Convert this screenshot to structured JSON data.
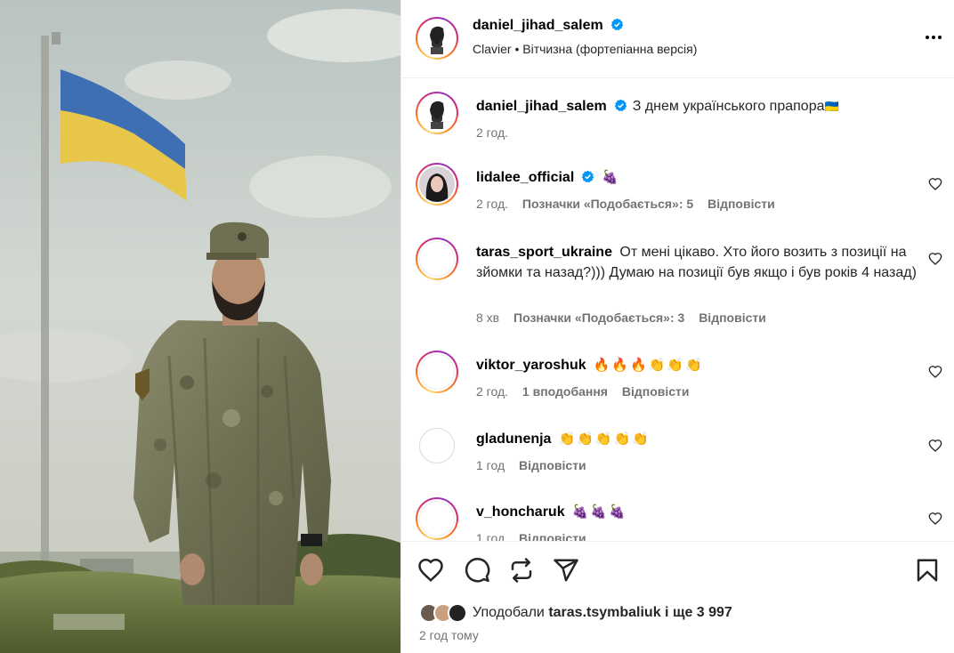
{
  "header": {
    "username": "daniel_jihad_salem",
    "audio": "Clavier • Вітчизна (фортепіанна версія)"
  },
  "caption": {
    "username": "daniel_jihad_salem",
    "text": "З днем українського прапора",
    "flag_emoji": "🇺🇦",
    "time": "2 год."
  },
  "comments": [
    {
      "username": "lidalee_official",
      "verified": true,
      "text": "",
      "emojis": "🍇",
      "time": "2 год.",
      "likes": "Позначки «Подобається»: 5",
      "reply": "Відповісти"
    },
    {
      "username": "taras_sport_ukraine",
      "verified": false,
      "text": "От мені цікаво. Хто його возить з позиції на зйомки та назад?))) Думаю на позиції був якщо і був років 4 назад)",
      "emojis": "",
      "time": "8 хв",
      "likes": "Позначки «Подобається»: 3",
      "reply": "Відповісти"
    },
    {
      "username": "viktor_yaroshuk",
      "verified": false,
      "text": "",
      "emojis": "🔥🔥🔥👏👏👏",
      "time": "2 год.",
      "likes": "1 вподобання",
      "reply": "Відповісти"
    },
    {
      "username": "gladunenja",
      "verified": false,
      "text": "",
      "emojis": "👏👏👏👏👏",
      "time": "1 год",
      "likes": "",
      "reply": "Відповісти"
    },
    {
      "username": "v_honcharuk",
      "verified": false,
      "text": "",
      "emojis": "🍇🍇🍇",
      "time": "1 год",
      "likes": "",
      "reply": "Відповісти"
    }
  ],
  "footer": {
    "liked_prefix": "Уподобали",
    "liked_user": "taras.tsymbaliuk",
    "liked_suffix": "і ще 3 997",
    "time": "2 год тому"
  },
  "icons": {
    "like": "heart-icon",
    "comment": "comment-bubble-icon",
    "repost": "repost-icon",
    "share": "paper-plane-icon",
    "save": "bookmark-icon",
    "more": "more-options-icon",
    "verified": "verified-badge-icon"
  },
  "colors": {
    "verified": "#0095f6",
    "muted": "#737373",
    "text": "#262626",
    "flag_blue": "#3f6fb3",
    "flag_yellow": "#e7c64a"
  }
}
